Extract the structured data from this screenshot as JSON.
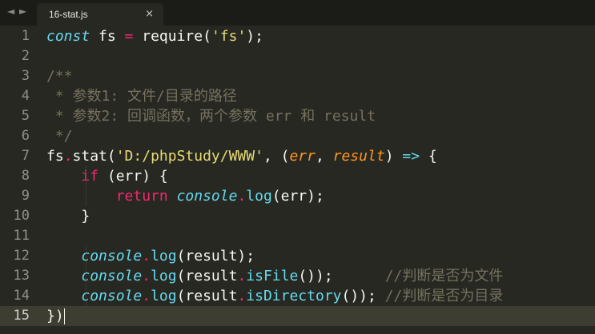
{
  "tabs": [
    {
      "label": "16-stat.js",
      "close_glyph": "×",
      "active": true
    }
  ],
  "nav": {
    "back": "◄",
    "forward": "►"
  },
  "current_line": 15,
  "editor": {
    "line_numbers": [
      "1",
      "2",
      "3",
      "4",
      "5",
      "6",
      "7",
      "8",
      "9",
      "10",
      "11",
      "12",
      "13",
      "14",
      "15"
    ],
    "lines": [
      {
        "tokens": [
          [
            "kw",
            "const"
          ],
          [
            "plain",
            " fs "
          ],
          [
            "op",
            "="
          ],
          [
            "plain",
            " require("
          ],
          [
            "str",
            "'fs'"
          ],
          [
            "plain",
            ");"
          ]
        ]
      },
      {
        "tokens": []
      },
      {
        "tokens": [
          [
            "cm",
            "/**"
          ]
        ]
      },
      {
        "tokens": [
          [
            "cm",
            " * 参数1: 文件/目录的路径"
          ]
        ]
      },
      {
        "tokens": [
          [
            "cm",
            " * 参数2: 回调函数，两个参数 err 和 result"
          ]
        ]
      },
      {
        "tokens": [
          [
            "cm",
            " */"
          ]
        ]
      },
      {
        "tokens": [
          [
            "plain",
            "fs"
          ],
          [
            "op",
            "."
          ],
          [
            "plain",
            "stat("
          ],
          [
            "str",
            "'D:/phpStudy/WWW'"
          ],
          [
            "plain",
            ", ("
          ],
          [
            "param",
            "err"
          ],
          [
            "plain",
            ", "
          ],
          [
            "param",
            "result"
          ],
          [
            "plain",
            ") "
          ],
          [
            "fn",
            "=>"
          ],
          [
            "plain",
            " {"
          ]
        ]
      },
      {
        "tokens": [
          [
            "plain",
            "    "
          ],
          [
            "kwr",
            "if"
          ],
          [
            "plain",
            " (err) {"
          ]
        ]
      },
      {
        "tokens": [
          [
            "plain",
            "        "
          ],
          [
            "kwr",
            "return"
          ],
          [
            "plain",
            " "
          ],
          [
            "obj",
            "console"
          ],
          [
            "op",
            "."
          ],
          [
            "fn",
            "log"
          ],
          [
            "plain",
            "(err);"
          ]
        ]
      },
      {
        "tokens": [
          [
            "plain",
            "    }"
          ]
        ]
      },
      {
        "tokens": []
      },
      {
        "tokens": [
          [
            "plain",
            "    "
          ],
          [
            "obj",
            "console"
          ],
          [
            "op",
            "."
          ],
          [
            "fn",
            "log"
          ],
          [
            "plain",
            "(result);"
          ]
        ]
      },
      {
        "tokens": [
          [
            "plain",
            "    "
          ],
          [
            "obj",
            "console"
          ],
          [
            "op",
            "."
          ],
          [
            "fn",
            "log"
          ],
          [
            "plain",
            "(result"
          ],
          [
            "op",
            "."
          ],
          [
            "fn",
            "isFile"
          ],
          [
            "plain",
            "());      "
          ],
          [
            "cm",
            "//判断是否为文件"
          ]
        ]
      },
      {
        "tokens": [
          [
            "plain",
            "    "
          ],
          [
            "obj",
            "console"
          ],
          [
            "op",
            "."
          ],
          [
            "fn",
            "log"
          ],
          [
            "plain",
            "(result"
          ],
          [
            "op",
            "."
          ],
          [
            "fn",
            "isDirectory"
          ],
          [
            "plain",
            "()); "
          ],
          [
            "cm",
            "//判断是否为目录"
          ]
        ]
      },
      {
        "tokens": [
          [
            "plain",
            "})"
          ]
        ]
      }
    ]
  },
  "colors": {
    "background": "#272822",
    "tabbar": "#1b1c17",
    "keyword_italic": "#66d9ef",
    "keyword": "#f92672",
    "string": "#e6db74",
    "comment": "#75715e",
    "parameter": "#fd971f"
  }
}
